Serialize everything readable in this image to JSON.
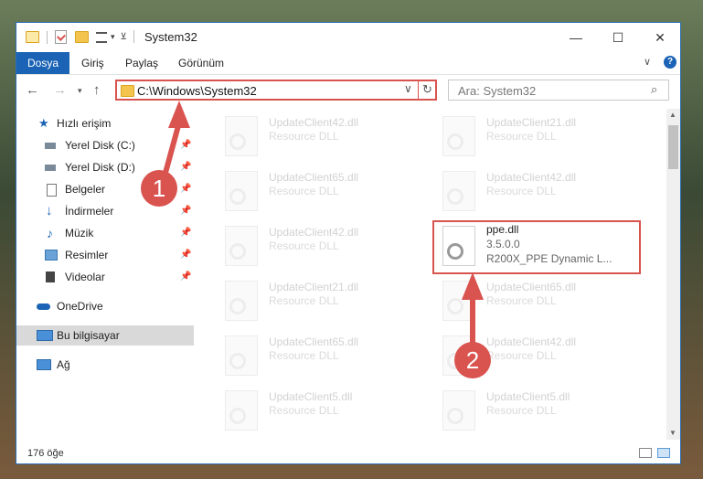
{
  "window": {
    "title": "System32"
  },
  "window_controls": {
    "minimize": "—",
    "maximize": "☐",
    "close": "✕"
  },
  "ribbon": {
    "tabs": [
      "Dosya",
      "Giriş",
      "Paylaş",
      "Görünüm"
    ],
    "expand": "∨",
    "help": "?"
  },
  "address": {
    "path": "C:\\Windows\\System32",
    "search_placeholder": "Ara: System32"
  },
  "nav": {
    "items": [
      {
        "label": "Hızlı erişim",
        "icon": "star-icon",
        "pinned": false
      },
      {
        "label": "Yerel Disk (C:)",
        "icon": "drive-icon",
        "pinned": true
      },
      {
        "label": "Yerel Disk (D:)",
        "icon": "drive-icon",
        "pinned": true
      },
      {
        "label": "Belgeler",
        "icon": "document-icon",
        "pinned": true
      },
      {
        "label": "İndirmeler",
        "icon": "download-icon",
        "pinned": true
      },
      {
        "label": "Müzik",
        "icon": "music-icon",
        "pinned": true
      },
      {
        "label": "Resimler",
        "icon": "pictures-icon",
        "pinned": true
      },
      {
        "label": "Videolar",
        "icon": "video-icon",
        "pinned": true
      },
      {
        "label": "OneDrive",
        "icon": "cloud-icon",
        "pinned": false
      },
      {
        "label": "Bu bilgisayar",
        "icon": "computer-icon",
        "pinned": false,
        "selected": true
      },
      {
        "label": "Ağ",
        "icon": "network-icon",
        "pinned": false
      }
    ]
  },
  "files": [
    {
      "name": "UpdateClient42.dll",
      "desc": "Resource DLL"
    },
    {
      "name": "UpdateClient21.dll",
      "desc": "Resource DLL"
    },
    {
      "name": "UpdateClient65.dll",
      "desc": "Resource DLL"
    },
    {
      "name": "UpdateClient42.dll",
      "desc": "Resource DLL"
    },
    {
      "name": "UpdateClient42.dll",
      "desc": "Resource DLL"
    },
    {
      "name": "ppe.dll",
      "desc": "3.5.0.0",
      "desc2": "R200X_PPE Dynamic L...",
      "highlighted": true
    },
    {
      "name": "UpdateClient21.dll",
      "desc": "Resource DLL"
    },
    {
      "name": "UpdateClient65.dll",
      "desc": "Resource DLL"
    },
    {
      "name": "UpdateClient65.dll",
      "desc": "Resource DLL"
    },
    {
      "name": "UpdateClient42.dll",
      "desc": "Resource DLL"
    },
    {
      "name": "UpdateClient5.dll",
      "desc": "Resource DLL"
    },
    {
      "name": "UpdateClient5.dll",
      "desc": "Resource DLL"
    }
  ],
  "status": {
    "count": "176 öğe"
  },
  "callouts": [
    "1",
    "2"
  ],
  "colors": {
    "accent": "#1a63b5",
    "highlight": "#d9534f"
  }
}
